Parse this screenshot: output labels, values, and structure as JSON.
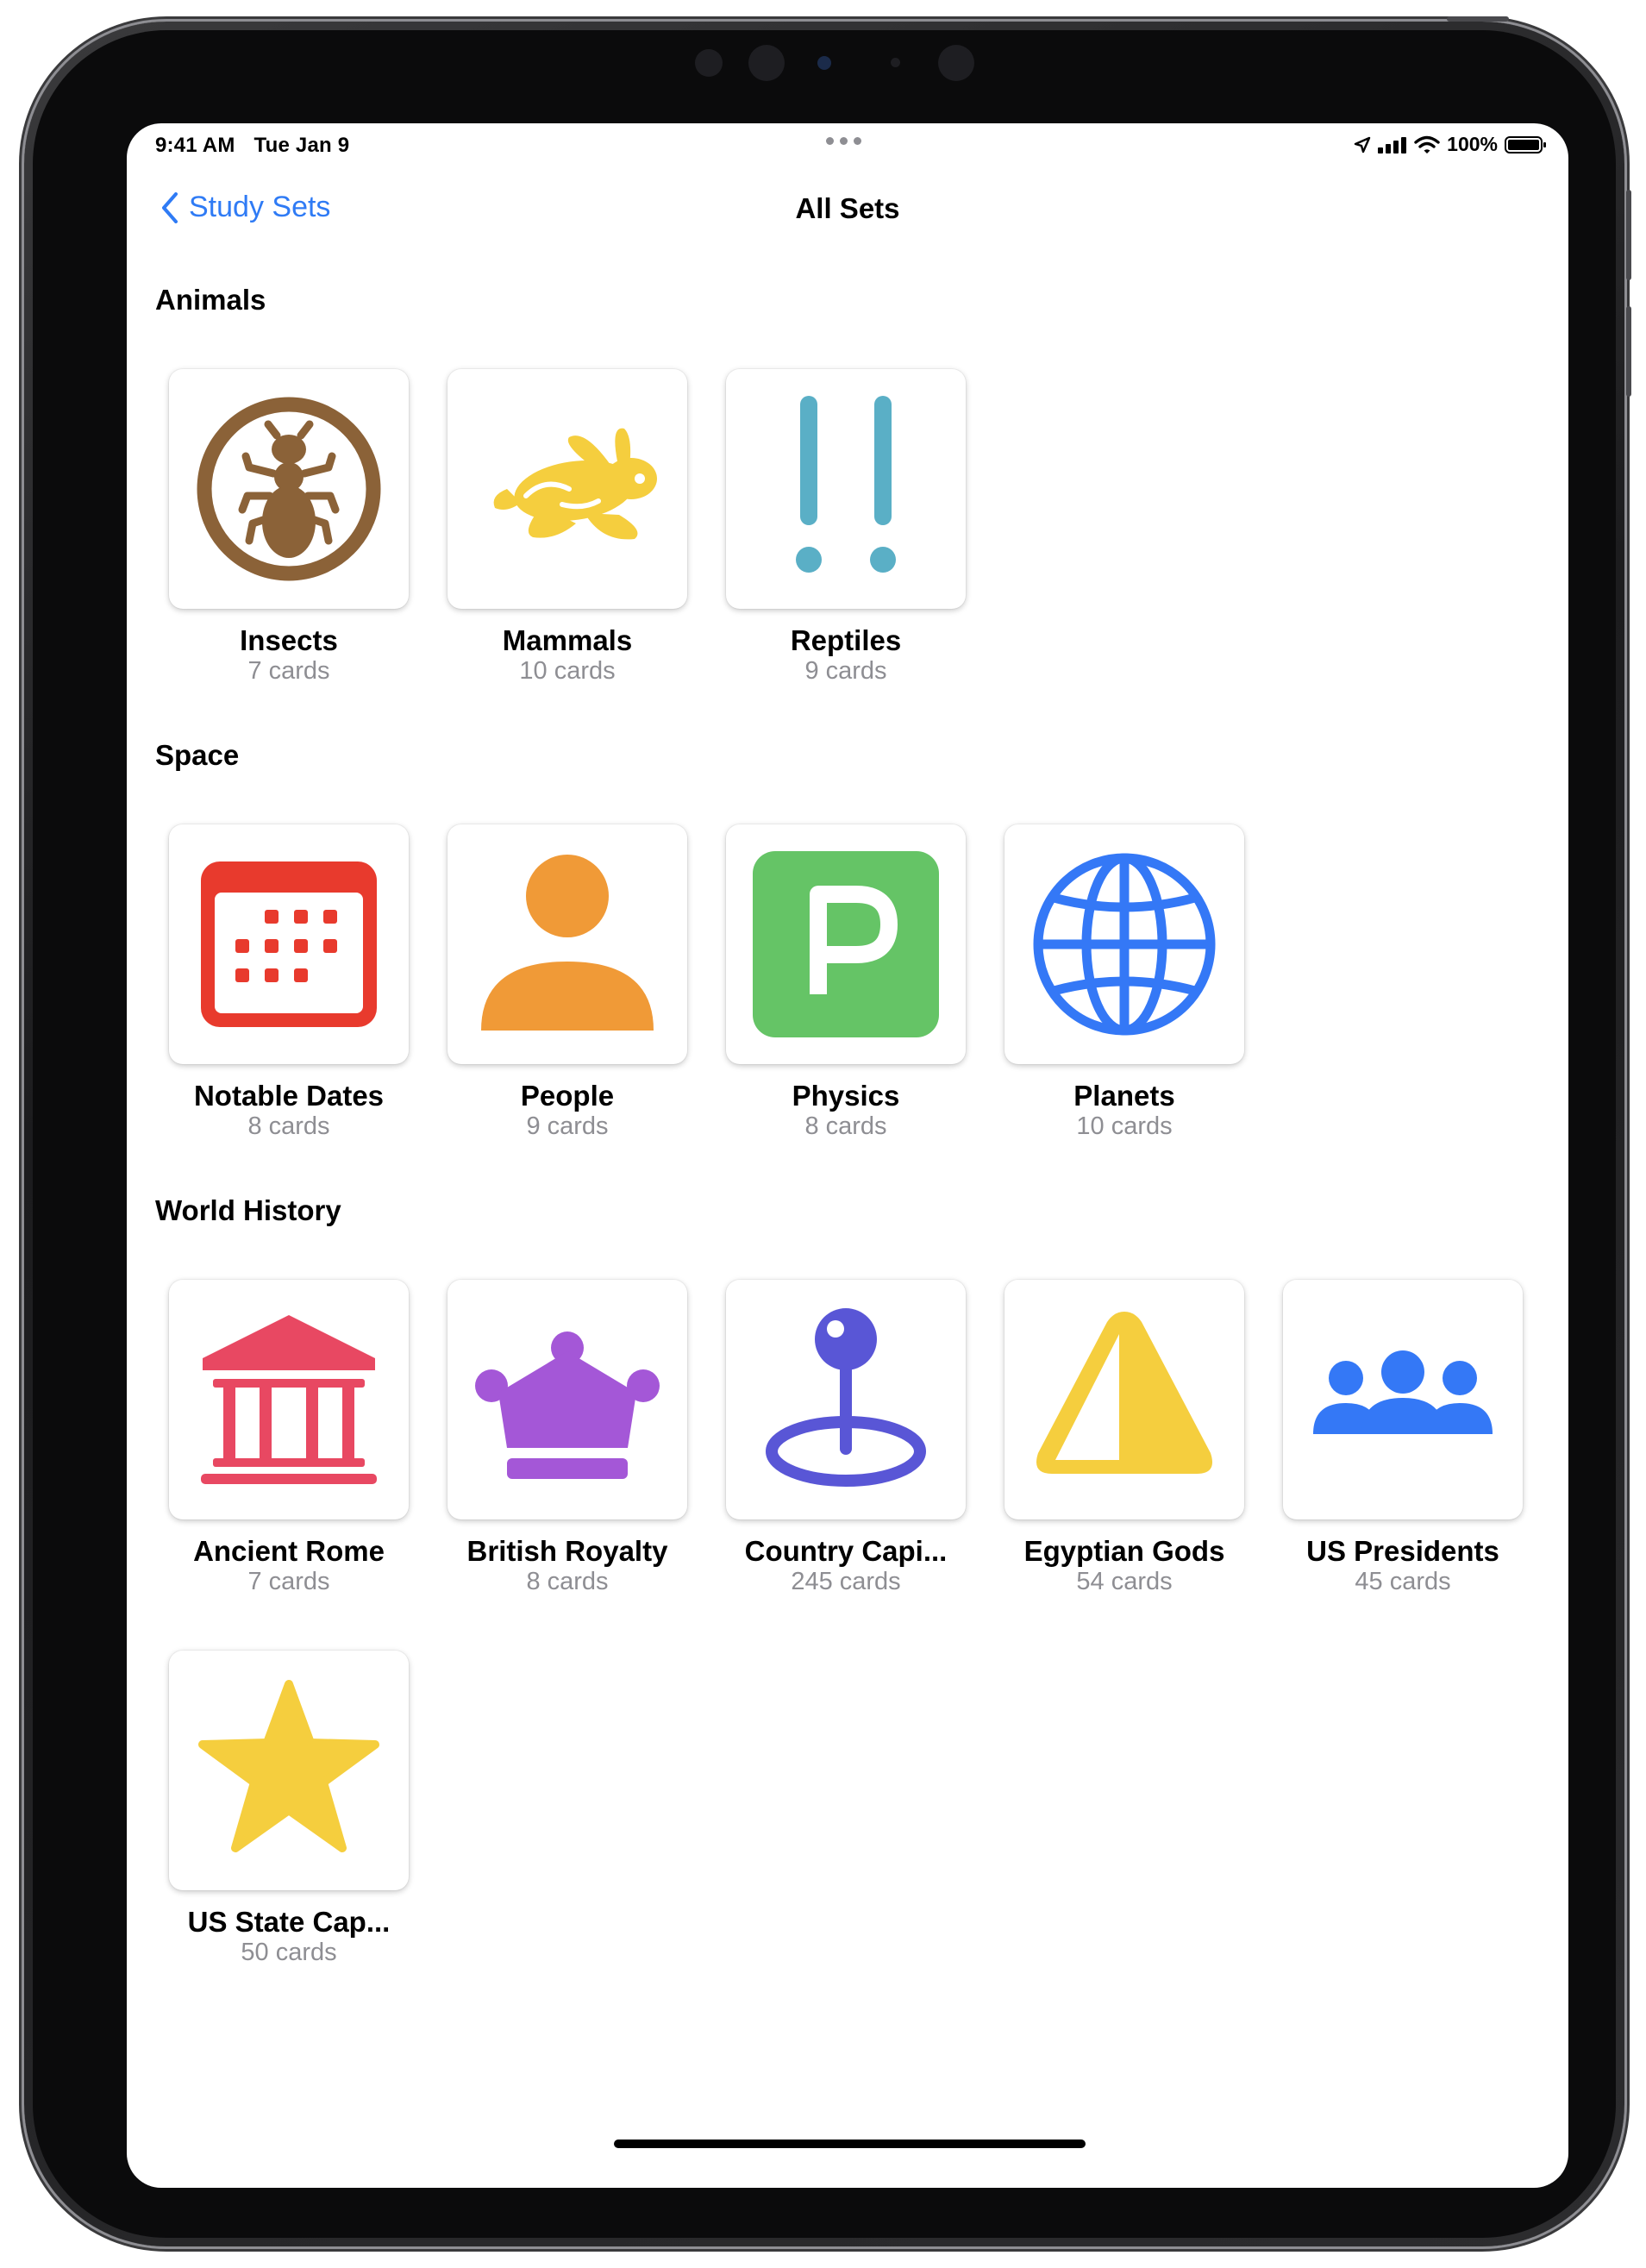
{
  "status_bar": {
    "time": "9:41 AM",
    "date": "Tue Jan 9",
    "battery": "100%"
  },
  "nav": {
    "back_label": "Study Sets",
    "title": "All Sets"
  },
  "colors": {
    "accent": "#2f7bf5",
    "secondary_text": "#8e8e93"
  },
  "sections": [
    {
      "title": "Animals",
      "sets": [
        {
          "name": "Insects",
          "count": "7 cards",
          "icon": "ant-icon",
          "color": "#8b6238"
        },
        {
          "name": "Mammals",
          "count": "10 cards",
          "icon": "hare-icon",
          "color": "#f5ce3e"
        },
        {
          "name": "Reptiles",
          "count": "9 cards",
          "icon": "exclamation-marks-icon",
          "color": "#5aafc6"
        }
      ]
    },
    {
      "title": "Space",
      "sets": [
        {
          "name": "Notable Dates",
          "count": "8 cards",
          "icon": "calendar-icon",
          "color": "#e83a2d"
        },
        {
          "name": "People",
          "count": "9 cards",
          "icon": "person-icon",
          "color": "#f09a37"
        },
        {
          "name": "Physics",
          "count": "8 cards",
          "icon": "letter-p-square-icon",
          "color": "#65c466"
        },
        {
          "name": "Planets",
          "count": "10 cards",
          "icon": "globe-icon",
          "color": "#3478f6"
        }
      ]
    },
    {
      "title": "World History",
      "sets": [
        {
          "name": "Ancient Rome",
          "count": "7 cards",
          "icon": "building-columns-icon",
          "color": "#e84862"
        },
        {
          "name": "British Royalty",
          "count": "8 cards",
          "icon": "crown-icon",
          "color": "#a457d7"
        },
        {
          "name": "Country Capi...",
          "count": "245 cards",
          "icon": "map-pin-icon",
          "color": "#5956d6"
        },
        {
          "name": "Egyptian Gods",
          "count": "54 cards",
          "icon": "pyramid-icon",
          "color": "#f5ce3e"
        },
        {
          "name": "US Presidents",
          "count": "45 cards",
          "icon": "people-group-icon",
          "color": "#3478f6"
        },
        {
          "name": "US State Cap...",
          "count": "50 cards",
          "icon": "star-icon",
          "color": "#f5ce3e"
        }
      ]
    }
  ]
}
